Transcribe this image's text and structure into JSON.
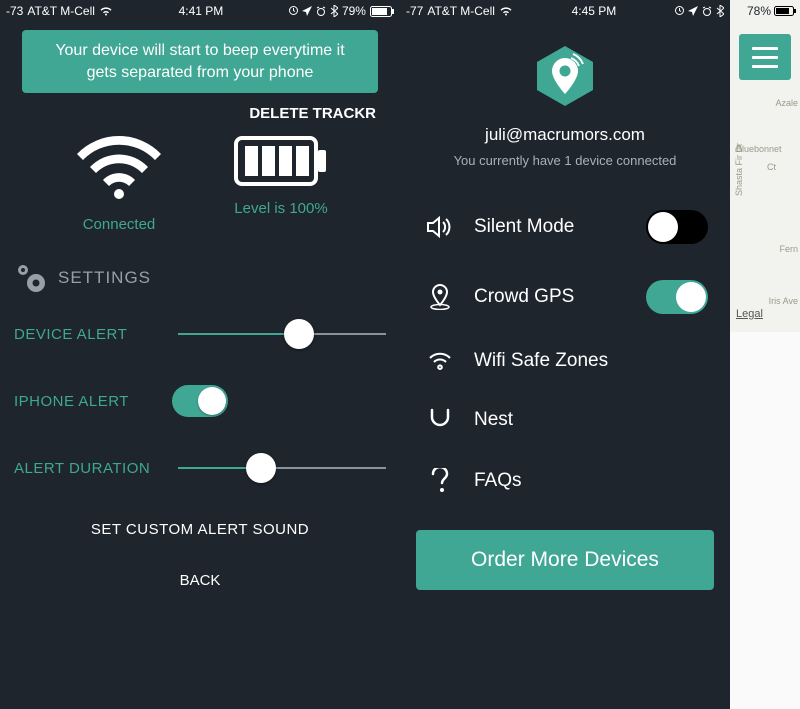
{
  "left": {
    "statusbar": {
      "signal": "-73",
      "carrier": "AT&T M-Cell",
      "time": "4:41 PM",
      "battery": "79%"
    },
    "banner": "Your device will start to beep everytime it gets separated from your phone",
    "delete_label": "DELETE TRACKR",
    "connected_label": "Connected",
    "battery_label": "Level is 100%",
    "settings_header": "SETTINGS",
    "device_alert_label": "DEVICE ALERT",
    "device_alert_value": 58,
    "iphone_alert_label": "IPHONE ALERT",
    "iphone_alert_on": true,
    "alert_duration_label": "ALERT DURATION",
    "alert_duration_value": 40,
    "custom_sound_label": "SET CUSTOM ALERT SOUND",
    "back_label": "BACK"
  },
  "right": {
    "statusbar": {
      "signal": "-77",
      "carrier": "AT&T M-Cell",
      "time": "4:45 PM",
      "battery": "78%"
    },
    "email": "juli@macrumors.com",
    "subtext": "You currently have 1 device connected",
    "menu": {
      "silent": {
        "label": "Silent Mode",
        "on": false
      },
      "crowd": {
        "label": "Crowd GPS",
        "on": true
      },
      "wifi": {
        "label": "Wifi Safe Zones"
      },
      "nest": {
        "label": "Nest"
      },
      "faq": {
        "label": "FAQs"
      }
    },
    "order_label": "Order More Devices",
    "map": {
      "legal": "Legal",
      "roads": [
        "Azale",
        "Bluebonnet",
        "Ct",
        "Shasta Fir Dr",
        "Fern",
        "Iris Ave"
      ]
    }
  }
}
